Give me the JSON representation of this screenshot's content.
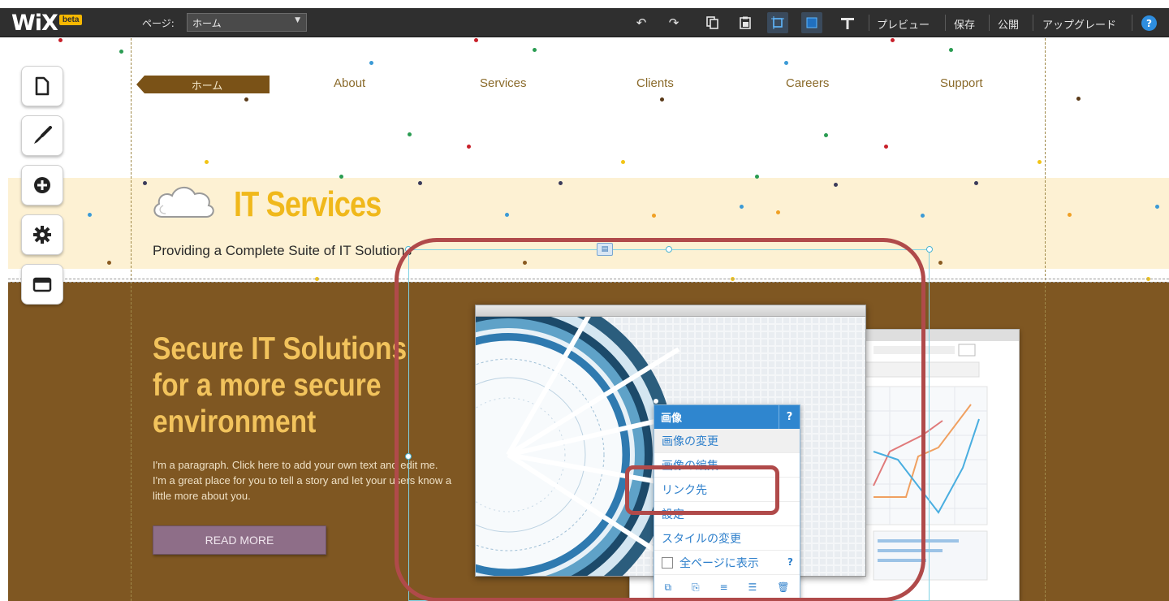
{
  "toolbar": {
    "logo": "WiX",
    "beta_badge": "beta",
    "page_label": "ページ:",
    "page_select_value": "ホーム",
    "preview": "プレビュー",
    "save": "保存",
    "publish": "公開",
    "upgrade": "アップグレード",
    "help": "?"
  },
  "site": {
    "nav": [
      "ホーム",
      "About",
      "Services",
      "Clients",
      "Careers",
      "Support"
    ],
    "title": "IT Services",
    "tagline": "Providing a Complete Suite of IT Solutions",
    "hero_title": [
      "Secure IT Solutions",
      "for a more secure",
      "environment"
    ],
    "paragraph": "I'm a paragraph. Click here to add your own text and edit me. I'm a great place for you to tell a story and let your users know a little more about you.",
    "read_more": "READ MORE"
  },
  "context_menu": {
    "header": "画像",
    "help": "?",
    "items": [
      "画像の変更",
      "画像の編集",
      "リンク先",
      "設定",
      "スタイルの変更"
    ],
    "show_all_pages": "全ページに表示"
  },
  "colors": {
    "toolbar_bg": "#2f2f2f",
    "accent_blue": "#2f86cf",
    "brand_gold": "#f0b81b",
    "brown": "#7f5722",
    "annotation_red": "#b04a4a"
  },
  "icons": {
    "rail": [
      "page-icon",
      "paint-brush-icon",
      "add-icon",
      "gear-icon",
      "store-icon"
    ],
    "toolbar": [
      "undo-icon",
      "redo-icon",
      "copy-icon",
      "paste-icon",
      "grid-icon",
      "snap-icon",
      "ruler-icon"
    ]
  }
}
